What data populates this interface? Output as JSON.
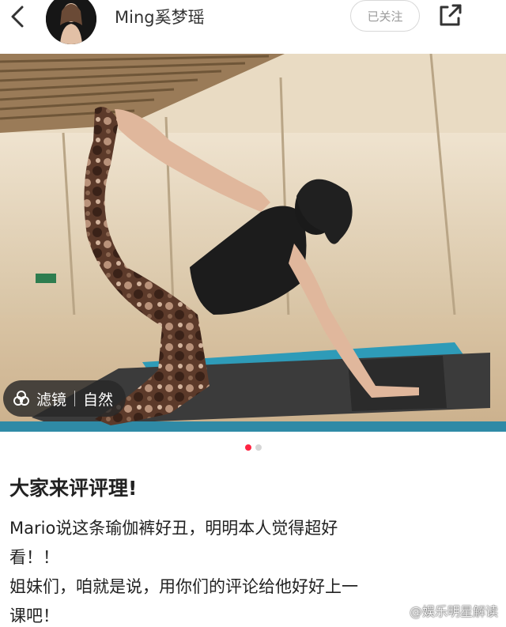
{
  "header": {
    "author_name": "Ming奚梦瑶",
    "follow_label": "已关注"
  },
  "photo": {
    "filter_label": "滤镜",
    "filter_value": "自然"
  },
  "pager": {
    "current": 1,
    "total": 2
  },
  "post": {
    "title": "大家来评评理!",
    "body_lines": [
      "Mario说这条瑜伽裤好丑，明明本人觉得超好",
      "看！！",
      "姐妹们，咱就是说，用你们的评论给他好好上一",
      "课吧！"
    ]
  },
  "watermark": {
    "text": "@娱乐明星解读"
  },
  "colors": {
    "accent": "#ff2442",
    "follow_border": "#d8d8d8",
    "follow_text": "#9a9a9a"
  },
  "icons": {
    "back": "chevron-left-icon",
    "share": "share-icon",
    "filter": "filter-icon"
  }
}
